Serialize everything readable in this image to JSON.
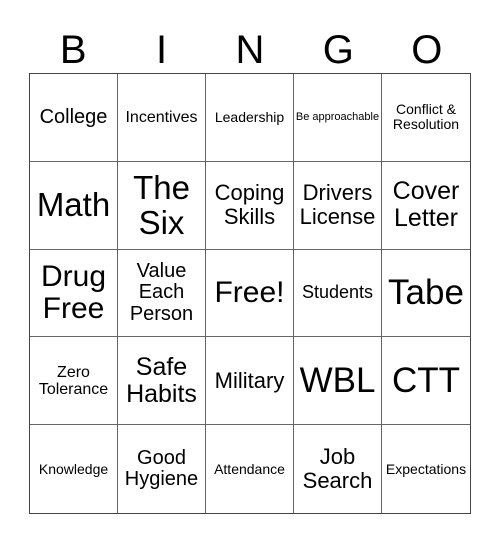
{
  "header": {
    "letters": [
      "B",
      "I",
      "N",
      "G",
      "O"
    ]
  },
  "cells": [
    "College",
    "Incentives",
    "Leadership",
    "Be approachable",
    "Conflict & Resolution",
    "Math",
    "The Six",
    "Coping Skills",
    "Drivers License",
    "Cover Letter",
    "Drug Free",
    "Value Each Person",
    "Free!",
    "Students",
    "Tabe",
    "Zero Tolerance",
    "Safe Habits",
    "Military",
    "WBL",
    "CTT",
    "Knowledge",
    "Good Hygiene",
    "Attendance",
    "Job Search",
    "Expectations"
  ]
}
